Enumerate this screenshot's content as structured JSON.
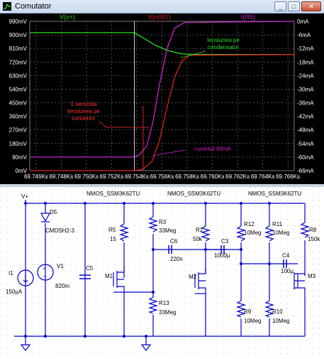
{
  "window": {
    "title": "Comutator",
    "minimize": "_",
    "maximize": "□",
    "close": "✕",
    "icon": "waveform-icon"
  },
  "colors": {
    "vplus": "#22dd22",
    "vn007": "#dd2020",
    "ir5": "#cc22cc",
    "grid": "#7a7a7a",
    "axis_text": "#ffffff",
    "annot_red": "#ff3333",
    "annot_green": "#22dd22",
    "annot_magenta": "#cc22cc",
    "schematic": "#0000ff",
    "wire": "#0000cc"
  },
  "chart_data": {
    "type": "line",
    "traces": [
      {
        "name": "V(v+)",
        "axis": "left",
        "color": "#22dd22"
      },
      {
        "name": "V(n007)",
        "axis": "left",
        "color": "#dd2020"
      },
      {
        "name": "I(R5)",
        "axis": "right",
        "color": "#cc22cc"
      }
    ],
    "x_ticks": [
      "69.746Ks",
      "69.748Ks",
      "69.750Ks",
      "69.752Ks",
      "69.754Ks",
      "69.756Ks",
      "69.758Ks",
      "69.760Ks",
      "69.762Ks",
      "69.764Ks",
      "69.766Ks"
    ],
    "xlim": [
      69.7455,
      69.7665
    ],
    "left_ticks": [
      "990mV",
      "900mV",
      "810mV",
      "720mV",
      "630mV",
      "540mV",
      "450mV",
      "360mV",
      "270mV",
      "180mV",
      "90mV",
      "0mV"
    ],
    "ylim_left": [
      0,
      990
    ],
    "right_ticks": [
      "0mA",
      "-6mA",
      "-12mA",
      "-18mA",
      "-24mA",
      "-30mA",
      "-36mA",
      "-42mA",
      "-48mA",
      "-54mA",
      "-60mA",
      "-66mA"
    ],
    "ylim_right": [
      -66,
      0
    ],
    "series": [
      {
        "name": "V(v+)",
        "x": [
          69.7455,
          69.7538,
          69.7545,
          69.7555,
          69.7565,
          69.7575,
          69.7585,
          69.7665
        ],
        "y": [
          915,
          915,
          880,
          830,
          795,
          775,
          770,
          770
        ]
      },
      {
        "name": "V(n007)",
        "x": [
          69.7455,
          69.7538,
          69.7545,
          69.7552,
          69.7558,
          69.7564,
          69.757,
          69.7576,
          69.7582,
          69.7665
        ],
        "y": [
          0,
          0,
          10,
          60,
          200,
          420,
          620,
          730,
          765,
          770
        ]
      },
      {
        "name": "I(R5)",
        "x": [
          69.7455,
          69.7538,
          69.7542,
          69.7548,
          69.7553,
          69.7558,
          69.7564,
          69.757,
          69.7578,
          69.7665
        ],
        "y": [
          -60,
          -60,
          -59,
          -55,
          -44,
          -28,
          -12,
          -3,
          -0.5,
          0
        ]
      }
    ],
    "annotations": [
      {
        "text": "tensiunea pe",
        "color": "#22dd22"
      },
      {
        "text": "condensator",
        "color": "#22dd22"
      },
      {
        "text": "1 secunda",
        "color": "#ff3333"
      },
      {
        "text": "tensiunea pe",
        "color": "#ff3333"
      },
      {
        "text": "convertor",
        "color": "#ff3333"
      },
      {
        "text": "curentul 60mA",
        "color": "#cc22cc"
      }
    ]
  },
  "schematic": {
    "labels": {
      "vplus": "V+",
      "d5": "D5",
      "d5_model": "CMDSH2-3",
      "i1": "I1",
      "i1_val": "150µA",
      "v1": "V1",
      "v1_val": "820m",
      "c5": "C5",
      "r5": "R5",
      "r5_val": "15",
      "m1": "M1",
      "nmos1": "NMOS_SSM3K62TU",
      "r3": "R3",
      "r3_val": "33Meg",
      "r13": "R13",
      "r13_val": "33Meg",
      "c6": "C6",
      "c6_val": "220n",
      "r2": "R2",
      "r2_val": "50k",
      "m2": "M2",
      "nmos2": "NMOS_SSM3K62TU",
      "c3": "C3",
      "c3_val": "1000µ",
      "r12": "R12",
      "r12_val": "10Meg",
      "r11": "R11",
      "r11_val": "10Meg",
      "r9": "R9",
      "r9_val": "10Meg",
      "r10": "R10",
      "r10_val": "10Meg",
      "c4": "C4",
      "c4_val": "100µ",
      "nmos3": "NMOS_SSM3K62TU",
      "r8": "R8",
      "r8_val": "150k",
      "m3": "M3"
    }
  }
}
